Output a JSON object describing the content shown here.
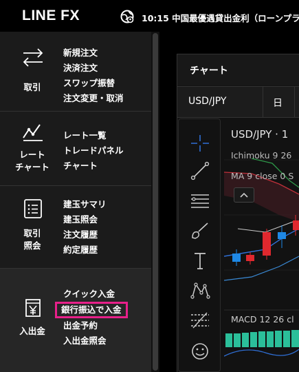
{
  "header": {
    "logo": "LINE FX",
    "ticker": "10:15 中国最優遇貸出金利（ローンプラ"
  },
  "sidebar": {
    "sections": [
      {
        "title": "取引",
        "icon": "exchange-arrows-icon",
        "items": [
          "新規注文",
          "決済注文",
          "スワップ振替",
          "注文変更・取消"
        ]
      },
      {
        "title_line1": "レート",
        "title_line2": "チャート",
        "icon": "line-chart-icon",
        "items": [
          "レート一覧",
          "トレードパネル",
          "チャート"
        ]
      },
      {
        "title_line1": "取引",
        "title_line2": "照会",
        "icon": "list-document-icon",
        "items": [
          "建玉サマリ",
          "建玉照会",
          "注文履歴",
          "約定履歴"
        ]
      },
      {
        "title": "入出金",
        "icon": "yen-wallet-icon",
        "items": [
          "クイック入金",
          "銀行振込で入金",
          "出金予約",
          "入出金照会"
        ],
        "highlighted_index": 1
      }
    ]
  },
  "chart": {
    "panel_title": "チャート",
    "pair": "USD/JPY",
    "period": "日",
    "symbol_label": "USD/JPY · 1",
    "ichimoku_label": "Ichimoku 9 26",
    "ma_label": "MA 9 close 0 S",
    "macd_label": "MACD 12 26 cl"
  },
  "colors": {
    "accent_highlight": "#e8208a",
    "tool_active": "#2f6fd6",
    "candle_up": "#e0282e",
    "candle_down": "#1e88e5",
    "macd_bar": "#2bbf9a"
  }
}
